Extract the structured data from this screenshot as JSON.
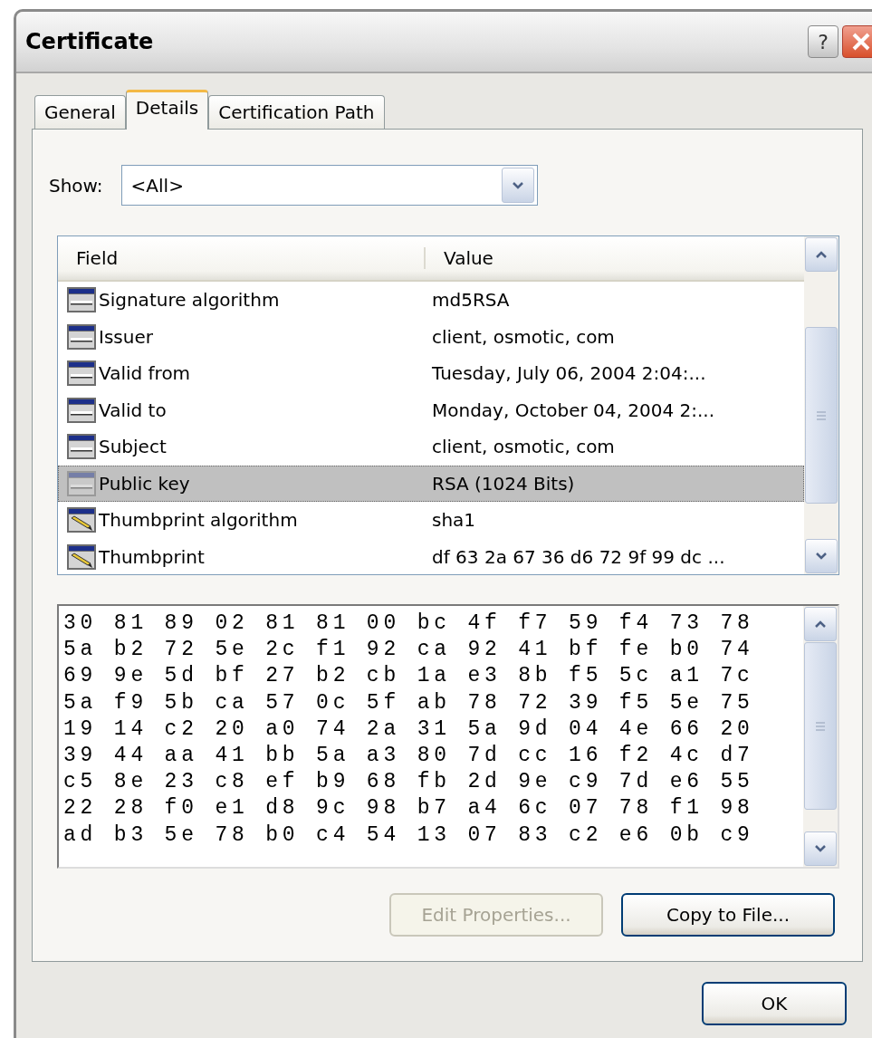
{
  "window": {
    "title": "Certificate",
    "help_button": "?"
  },
  "tabs": [
    {
      "label": "General",
      "selected": false
    },
    {
      "label": "Details",
      "selected": true
    },
    {
      "label": "Certification Path",
      "selected": false
    }
  ],
  "show": {
    "label": "Show:",
    "value": "<All>"
  },
  "field_list": {
    "columns": [
      "Field",
      "Value"
    ],
    "rows": [
      {
        "field": "Signature algorithm",
        "value": "md5RSA",
        "kind": "field",
        "selected": false
      },
      {
        "field": "Issuer",
        "value": "client, osmotic, com",
        "kind": "field",
        "selected": false
      },
      {
        "field": "Valid from",
        "value": "Tuesday, July 06, 2004 2:04:...",
        "kind": "field",
        "selected": false
      },
      {
        "field": "Valid to",
        "value": "Monday, October 04, 2004 2:...",
        "kind": "field",
        "selected": false
      },
      {
        "field": "Subject",
        "value": "client, osmotic, com",
        "kind": "field",
        "selected": false
      },
      {
        "field": "Public key",
        "value": "RSA (1024 Bits)",
        "kind": "field",
        "selected": true
      },
      {
        "field": "Thumbprint algorithm",
        "value": "sha1",
        "kind": "thumbprint",
        "selected": false
      },
      {
        "field": "Thumbprint",
        "value": "df 63 2a 67 36 d6 72 9f 99 dc ...",
        "kind": "thumbprint",
        "selected": false
      }
    ]
  },
  "hex_view": {
    "lines": [
      "30 81 89 02 81 81 00 bc 4f f7 59 f4 73 78",
      "5a b2 72 5e 2c f1 92 ca 92 41 bf fe b0 74",
      "69 9e 5d bf 27 b2 cb 1a e3 8b f5 5c a1 7c",
      "5a f9 5b ca 57 0c 5f ab 78 72 39 f5 5e 75",
      "19 14 c2 20 a0 74 2a 31 5a 9d 04 4e 66 20",
      "39 44 aa 41 bb 5a a3 80 7d cc 16 f2 4c d7",
      "c5 8e 23 c8 ef b9 68 fb 2d 9e c9 7d e6 55",
      "22 28 f0 e1 d8 9c 98 b7 a4 6c 07 78 f1 98",
      "ad b3 5e 78 b0 c4 54 13 07 83 c2 e6 0b c9"
    ]
  },
  "buttons": [
    {
      "label": "Edit Properties...",
      "disabled": true
    },
    {
      "label": "Copy to File...",
      "disabled": false
    }
  ],
  "ok_button": {
    "label": "OK"
  }
}
